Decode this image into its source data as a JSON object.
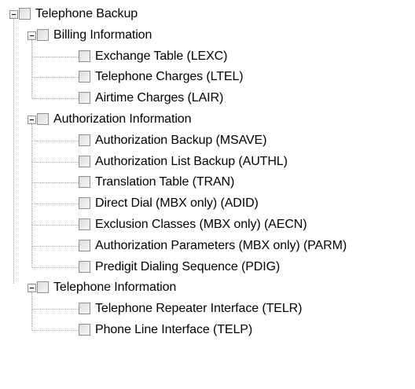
{
  "tree": {
    "root": {
      "label": "Telephone Backup",
      "expanded": true,
      "checked": false,
      "children": [
        {
          "label": "Billing Information",
          "expanded": true,
          "checked": false,
          "children": [
            {
              "label": "Exchange Table (LEXC)",
              "checked": false
            },
            {
              "label": "Telephone Charges (LTEL)",
              "checked": false
            },
            {
              "label": "Airtime Charges (LAIR)",
              "checked": false
            }
          ]
        },
        {
          "label": "Authorization Information",
          "expanded": true,
          "checked": false,
          "children": [
            {
              "label": "Authorization Backup (MSAVE)",
              "checked": false
            },
            {
              "label": "Authorization List Backup (AUTHL)",
              "checked": false
            },
            {
              "label": "Translation Table (TRAN)",
              "checked": false
            },
            {
              "label": "Direct Dial (MBX only) (ADID)",
              "checked": false
            },
            {
              "label": "Exclusion Classes (MBX only) (AECN)",
              "checked": false
            },
            {
              "label": "Authorization Parameters (MBX only) (PARM)",
              "checked": false
            },
            {
              "label": "Predigit Dialing Sequence (PDIG)",
              "checked": false
            }
          ]
        },
        {
          "label": "Telephone Information",
          "expanded": true,
          "checked": false,
          "children": [
            {
              "label": "Telephone Repeater Interface (TELR)",
              "checked": false
            },
            {
              "label": "Phone Line Interface (TELP)",
              "checked": false
            }
          ]
        }
      ]
    },
    "icons": {
      "expander": "collapse-minus-icon",
      "checkbox": "unchecked-checkbox-icon"
    },
    "colors": {
      "background": "#ffffff",
      "text": "#000000",
      "connector": "#a0a0a0",
      "checkbox_border": "#8e8f8f",
      "expander_border": "#919191"
    }
  }
}
